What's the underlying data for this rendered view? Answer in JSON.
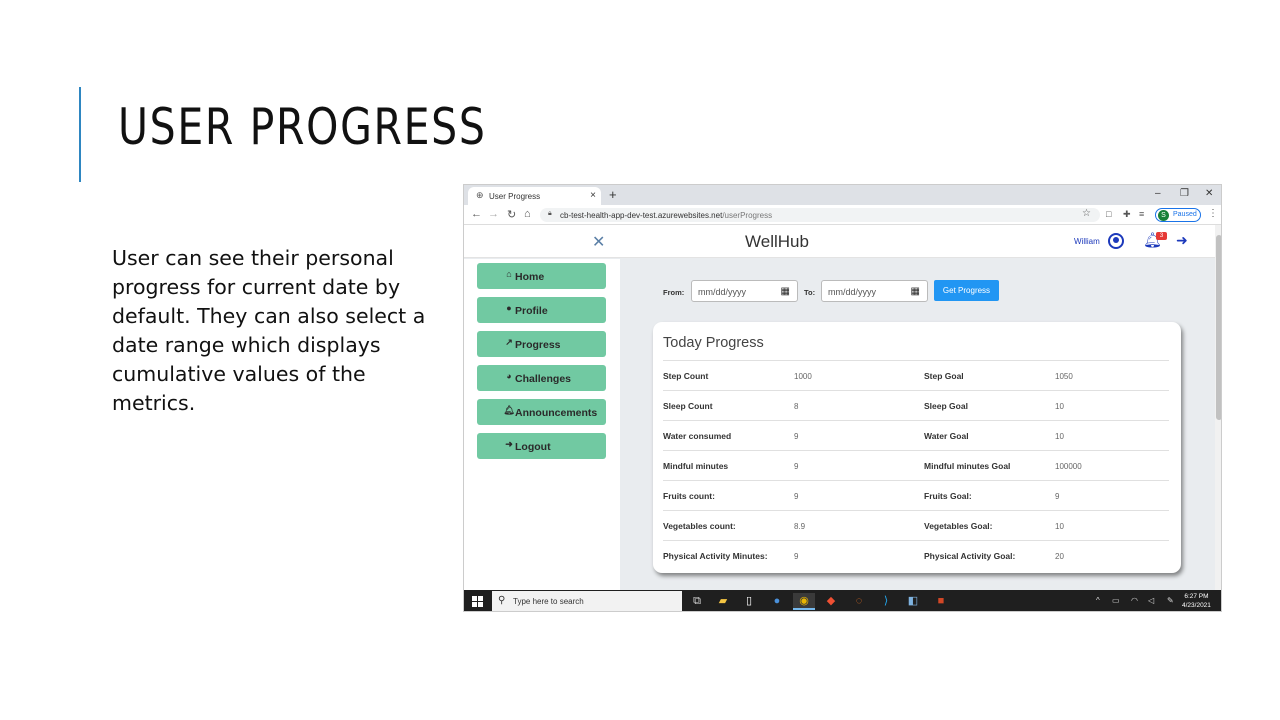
{
  "slide": {
    "title": "USER PROGRESS",
    "body": "User can see their personal progress for current date by default. They can also select a date range which displays cumulative values of the metrics.",
    "accent_color": "#2e86c1"
  },
  "browser": {
    "tab_title": "User Progress",
    "tab_close": "×",
    "new_tab": "+",
    "window_controls": [
      "–",
      "❐",
      "✕"
    ],
    "url_domain": "cb-test-health-app-dev-test.azurewebsites.net",
    "url_path": "/userProgress",
    "profile_initial": "S",
    "profile_status": "Paused"
  },
  "app": {
    "brand": "WellHub",
    "user_name": "William",
    "notification_count": "3",
    "accent_color": "#1c39bb"
  },
  "sidebar": {
    "button_color": "#71c9a2",
    "items": [
      {
        "label": "Home",
        "icon": "home-icon"
      },
      {
        "label": "Profile",
        "icon": "user-icon"
      },
      {
        "label": "Progress",
        "icon": "chart-line-icon"
      },
      {
        "label": "Challenges",
        "icon": "pie-chart-icon"
      },
      {
        "label": "Announcements",
        "icon": "bell-icon"
      },
      {
        "label": "Logout",
        "icon": "sign-out-icon"
      }
    ]
  },
  "filter": {
    "from_label": "From:",
    "to_label": "To:",
    "from_placeholder": "mm/dd/yyyy",
    "to_placeholder": "mm/dd/yyyy",
    "button_label": "Get Progress",
    "button_color": "#2196f3"
  },
  "progress": {
    "title": "Today Progress",
    "rows": [
      {
        "metric": "Step Count",
        "value": "1000",
        "goal_label": "Step Goal",
        "goal": "1050"
      },
      {
        "metric": "Sleep Count",
        "value": "8",
        "goal_label": "Sleep Goal",
        "goal": "10"
      },
      {
        "metric": "Water consumed",
        "value": "9",
        "goal_label": "Water Goal",
        "goal": "10"
      },
      {
        "metric": "Mindful minutes",
        "value": "9",
        "goal_label": "Mindful minutes Goal",
        "goal": "100000"
      },
      {
        "metric": "Fruits count:",
        "value": "9",
        "goal_label": "Fruits Goal:",
        "goal": "9"
      },
      {
        "metric": "Vegetables count:",
        "value": "8.9",
        "goal_label": "Vegetables Goal:",
        "goal": "10"
      },
      {
        "metric": "Physical Activity Minutes:",
        "value": "9",
        "goal_label": "Physical Activity Goal:",
        "goal": "20"
      }
    ]
  },
  "taskbar": {
    "search_placeholder": "Type here to search",
    "time": "6:27 PM",
    "date": "4/23/2021"
  }
}
